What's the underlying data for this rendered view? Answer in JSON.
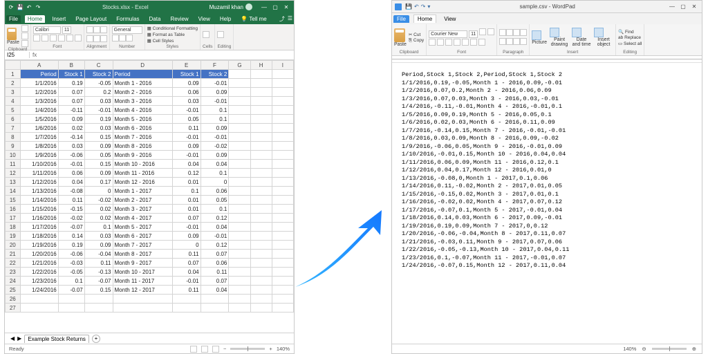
{
  "excel": {
    "app_title": "Stocks.xlsx - Excel",
    "user": "Muzamil khan",
    "tabs": {
      "file": "File",
      "home": "Home",
      "insert": "Insert",
      "page_layout": "Page Layout",
      "formulas": "Formulas",
      "data": "Data",
      "review": "Review",
      "view": "View",
      "help": "Help",
      "tellme": "Tell me"
    },
    "ribbon": {
      "clipboard_label": "Clipboard",
      "paste": "Paste",
      "font_label": "Font",
      "font_name": "Calibri",
      "font_size": "11",
      "alignment_label": "Alignment",
      "number_label": "Number",
      "number_format": "General",
      "styles_label": "Styles",
      "cond_format": "Conditional Formatting",
      "as_table": "Format as Table",
      "cell_styles": "Cell Styles",
      "cells_label": "Cells",
      "editing_label": "Editing"
    },
    "namebox": "I25",
    "columns": [
      "A",
      "B",
      "C",
      "D",
      "E",
      "F",
      "G",
      "H",
      "I"
    ],
    "header_row": [
      "Period",
      "Stock 1",
      "Stock 2",
      "Period",
      "Stock 1",
      "Stock 2"
    ],
    "rows": [
      [
        "1/1/2016",
        "0.19",
        "-0.05",
        "Month 1 - 2016",
        "0.09",
        "-0.01"
      ],
      [
        "1/2/2016",
        "0.07",
        "0.2",
        "Month 2 - 2016",
        "0.06",
        "0.09"
      ],
      [
        "1/3/2016",
        "0.07",
        "0.03",
        "Month 3 - 2016",
        "0.03",
        "-0.01"
      ],
      [
        "1/4/2016",
        "-0.11",
        "-0.01",
        "Month 4 - 2016",
        "-0.01",
        "0.1"
      ],
      [
        "1/5/2016",
        "0.09",
        "0.19",
        "Month 5 - 2016",
        "0.05",
        "0.1"
      ],
      [
        "1/6/2016",
        "0.02",
        "0.03",
        "Month 6 - 2016",
        "0.11",
        "0.09"
      ],
      [
        "1/7/2016",
        "-0.14",
        "0.15",
        "Month 7 - 2016",
        "-0.01",
        "-0.01"
      ],
      [
        "1/8/2016",
        "0.03",
        "0.09",
        "Month 8 - 2016",
        "0.09",
        "-0.02"
      ],
      [
        "1/9/2016",
        "-0.06",
        "0.05",
        "Month 9 - 2016",
        "-0.01",
        "0.09"
      ],
      [
        "1/10/2016",
        "-0.01",
        "0.15",
        "Month 10 - 2016",
        "0.04",
        "0.04"
      ],
      [
        "1/11/2016",
        "0.06",
        "0.09",
        "Month 11 - 2016",
        "0.12",
        "0.1"
      ],
      [
        "1/12/2016",
        "0.04",
        "0.17",
        "Month 12 - 2016",
        "0.01",
        "0"
      ],
      [
        "1/13/2016",
        "-0.08",
        "0",
        "Month 1 - 2017",
        "0.1",
        "0.06"
      ],
      [
        "1/14/2016",
        "0.11",
        "-0.02",
        "Month 2 - 2017",
        "0.01",
        "0.05"
      ],
      [
        "1/15/2016",
        "-0.15",
        "0.02",
        "Month 3 - 2017",
        "0.01",
        "0.1"
      ],
      [
        "1/16/2016",
        "-0.02",
        "0.02",
        "Month 4 - 2017",
        "0.07",
        "0.12"
      ],
      [
        "1/17/2016",
        "-0.07",
        "0.1",
        "Month 5 - 2017",
        "-0.01",
        "0.04"
      ],
      [
        "1/18/2016",
        "0.14",
        "0.03",
        "Month 6 - 2017",
        "0.09",
        "-0.01"
      ],
      [
        "1/19/2016",
        "0.19",
        "0.09",
        "Month 7 - 2017",
        "0",
        "0.12"
      ],
      [
        "1/20/2016",
        "-0.06",
        "-0.04",
        "Month 8 - 2017",
        "0.11",
        "0.07"
      ],
      [
        "1/21/2016",
        "-0.03",
        "0.11",
        "Month 9 - 2017",
        "0.07",
        "0.06"
      ],
      [
        "1/22/2016",
        "-0.05",
        "-0.13",
        "Month 10 - 2017",
        "0.04",
        "0.11"
      ],
      [
        "1/23/2016",
        "0.1",
        "-0.07",
        "Month 11 - 2017",
        "-0.01",
        "0.07"
      ],
      [
        "1/24/2016",
        "-0.07",
        "0.15",
        "Month 12 - 2017",
        "0.11",
        "0.04"
      ]
    ],
    "empty_rows": [
      "26",
      "27"
    ],
    "sheet_tab": "Example Stock Returns",
    "status": "Ready",
    "zoom": "140%"
  },
  "wordpad": {
    "app_title": "sample.csv - WordPad",
    "tabs": {
      "file": "File",
      "home": "Home",
      "view": "View"
    },
    "ribbon": {
      "clipboard_label": "Clipboard",
      "paste": "Paste",
      "cut": "Cut",
      "copy": "Copy",
      "font_label": "Font",
      "font_name": "Courier New",
      "font_size": "11",
      "paragraph_label": "Paragraph",
      "insert_label": "Insert",
      "picture": "Picture",
      "paint": "Paint drawing",
      "datetime": "Date and time",
      "object": "Insert object",
      "editing_label": "Editing",
      "find": "Find",
      "replace": "Replace",
      "select_all": "Select all"
    },
    "csv_lines": [
      "Period,Stock 1,Stock 2,Period,Stock 1,Stock 2",
      "1/1/2016,0.19,-0.05,Month 1 - 2016,0.09,-0.01",
      "1/2/2016,0.07,0.2,Month 2 - 2016,0.06,0.09",
      "1/3/2016,0.07,0.03,Month 3 - 2016,0.03,-0.01",
      "1/4/2016,-0.11,-0.01,Month 4 - 2016,-0.01,0.1",
      "1/5/2016,0.09,0.19,Month 5 - 2016,0.05,0.1",
      "1/6/2016,0.02,0.03,Month 6 - 2016,0.11,0.09",
      "1/7/2016,-0.14,0.15,Month 7 - 2016,-0.01,-0.01",
      "1/8/2016,0.03,0.09,Month 8 - 2016,0.09,-0.02",
      "1/9/2016,-0.06,0.05,Month 9 - 2016,-0.01,0.09",
      "1/10/2016,-0.01,0.15,Month 10 - 2016,0.04,0.04",
      "1/11/2016,0.06,0.09,Month 11 - 2016,0.12,0.1",
      "1/12/2016,0.04,0.17,Month 12 - 2016,0.01,0",
      "1/13/2016,-0.08,0,Month 1 - 2017,0.1,0.06",
      "1/14/2016,0.11,-0.02,Month 2 - 2017,0.01,0.05",
      "1/15/2016,-0.15,0.02,Month 3 - 2017,0.01,0.1",
      "1/16/2016,-0.02,0.02,Month 4 - 2017,0.07,0.12",
      "1/17/2016,-0.07,0.1,Month 5 - 2017,-0.01,0.04",
      "1/18/2016,0.14,0.03,Month 6 - 2017,0.09,-0.01",
      "1/19/2016,0.19,0.09,Month 7 - 2017,0,0.12",
      "1/20/2016,-0.06,-0.04,Month 8 - 2017,0.11,0.07",
      "1/21/2016,-0.03,0.11,Month 9 - 2017,0.07,0.06",
      "1/22/2016,-0.05,-0.13,Month 10 - 2017,0.04,0.11",
      "1/23/2016,0.1,-0.07,Month 11 - 2017,-0.01,0.07",
      "1/24/2016,-0.07,0.15,Month 12 - 2017,0.11,0.04"
    ],
    "zoom": "140%"
  }
}
